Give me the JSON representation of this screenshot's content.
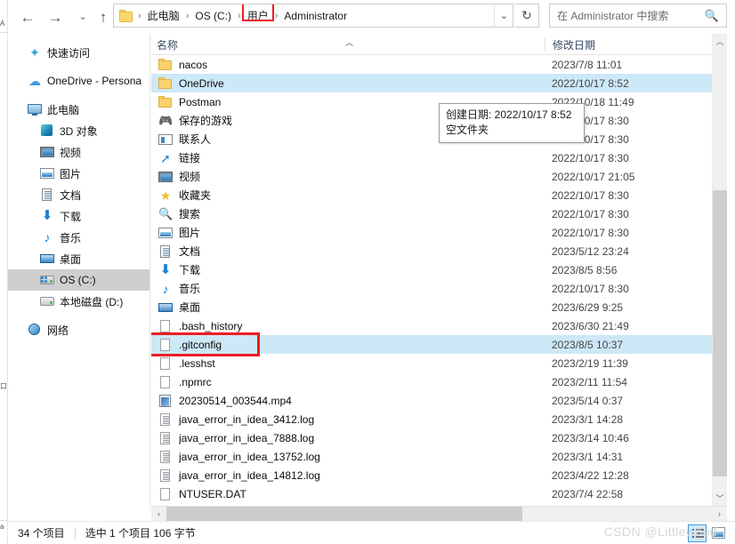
{
  "toolbar": {
    "back_label": "←",
    "forward_label": "→",
    "recent_label": "⌄",
    "up_label": "↑",
    "breadcrumb": [
      "此电脑",
      "OS (C:)",
      "用户",
      "Administrator"
    ],
    "breadcrumb_highlighted_index": 2,
    "dropdown_label": "⌄",
    "refresh_label": "↻",
    "search_placeholder": "在 Administrator 中搜索",
    "search_value": "",
    "search_icon": "search-icon"
  },
  "sidebar": {
    "items": [
      {
        "label": "快速访问",
        "icon": "pin-star-icon",
        "indent": 0,
        "selected": false
      },
      {
        "label": "OneDrive - Persona",
        "icon": "cloud-icon",
        "indent": 0,
        "selected": false
      },
      {
        "label": "此电脑",
        "icon": "this-pc-monitor-icon",
        "indent": 0,
        "selected": false
      },
      {
        "label": "3D 对象",
        "icon": "3d-objects-icon",
        "indent": 1,
        "selected": false
      },
      {
        "label": "视频",
        "icon": "videos-icon",
        "indent": 1,
        "selected": false
      },
      {
        "label": "图片",
        "icon": "pictures-icon",
        "indent": 1,
        "selected": false
      },
      {
        "label": "文档",
        "icon": "documents-icon",
        "indent": 1,
        "selected": false
      },
      {
        "label": "下载",
        "icon": "downloads-icon",
        "indent": 1,
        "selected": false
      },
      {
        "label": "音乐",
        "icon": "music-icon",
        "indent": 1,
        "selected": false
      },
      {
        "label": "桌面",
        "icon": "desktop-icon",
        "indent": 1,
        "selected": false
      },
      {
        "label": "OS (C:)",
        "icon": "os-drive-icon",
        "indent": 1,
        "selected": true
      },
      {
        "label": "本地磁盘 (D:)",
        "icon": "local-disk-icon",
        "indent": 1,
        "selected": false
      },
      {
        "label": "网络",
        "icon": "network-icon",
        "indent": 0,
        "selected": false
      }
    ]
  },
  "list": {
    "columns": {
      "name": "名称",
      "date_modified": "修改日期"
    },
    "sort_arrow": "︿",
    "rows": [
      {
        "name": "nacos",
        "date": "2023/7/8 11:01",
        "icon": "folder-icon",
        "selected": false,
        "outlined": false
      },
      {
        "name": "OneDrive",
        "date": "2022/10/17 8:52",
        "icon": "folder-icon",
        "selected": true,
        "outlined": false
      },
      {
        "name": "Postman",
        "date": "2022/10/18 11:49",
        "icon": "folder-icon",
        "selected": false,
        "outlined": false
      },
      {
        "name": "保存的游戏",
        "date": "2022/10/17 8:30",
        "icon": "saved-games-icon",
        "selected": false,
        "outlined": false
      },
      {
        "name": "联系人",
        "date": "2022/10/17 8:30",
        "icon": "contacts-icon",
        "selected": false,
        "outlined": false
      },
      {
        "name": "链接",
        "date": "2022/10/17 8:30",
        "icon": "links-icon",
        "selected": false,
        "outlined": false
      },
      {
        "name": "视频",
        "date": "2022/10/17 21:05",
        "icon": "videos-icon",
        "selected": false,
        "outlined": false
      },
      {
        "name": "收藏夹",
        "date": "2022/10/17 8:30",
        "icon": "favorites-star-icon",
        "selected": false,
        "outlined": false
      },
      {
        "name": "搜索",
        "date": "2022/10/17 8:30",
        "icon": "searches-icon",
        "selected": false,
        "outlined": false
      },
      {
        "name": "图片",
        "date": "2022/10/17 8:30",
        "icon": "pictures-icon",
        "selected": false,
        "outlined": false
      },
      {
        "name": "文档",
        "date": "2023/5/12 23:24",
        "icon": "documents-icon",
        "selected": false,
        "outlined": false
      },
      {
        "name": "下载",
        "date": "2023/8/5 8:56",
        "icon": "downloads-icon",
        "selected": false,
        "outlined": false
      },
      {
        "name": "音乐",
        "date": "2022/10/17 8:30",
        "icon": "music-icon",
        "selected": false,
        "outlined": false
      },
      {
        "name": "桌面",
        "date": "2023/6/29 9:25",
        "icon": "desktop-icon",
        "selected": false,
        "outlined": false
      },
      {
        "name": ".bash_history",
        "date": "2023/6/30 21:49",
        "icon": "file-blank-icon",
        "selected": false,
        "outlined": false
      },
      {
        "name": ".gitconfig",
        "date": "2023/8/5 10:37",
        "icon": "file-blank-icon",
        "selected": true,
        "outlined": true
      },
      {
        "name": ".lesshst",
        "date": "2023/2/19 11:39",
        "icon": "file-blank-icon",
        "selected": false,
        "outlined": false
      },
      {
        "name": ".npmrc",
        "date": "2023/2/11 11:54",
        "icon": "file-blank-icon",
        "selected": false,
        "outlined": false
      },
      {
        "name": "20230514_003544.mp4",
        "date": "2023/5/14 0:37",
        "icon": "video-file-icon",
        "selected": false,
        "outlined": false
      },
      {
        "name": "java_error_in_idea_3412.log",
        "date": "2023/3/1 14:28",
        "icon": "log-file-icon",
        "selected": false,
        "outlined": false
      },
      {
        "name": "java_error_in_idea_7888.log",
        "date": "2023/3/14 10:46",
        "icon": "log-file-icon",
        "selected": false,
        "outlined": false
      },
      {
        "name": "java_error_in_idea_13752.log",
        "date": "2023/3/1 14:31",
        "icon": "log-file-icon",
        "selected": false,
        "outlined": false
      },
      {
        "name": "java_error_in_idea_14812.log",
        "date": "2023/4/22 12:28",
        "icon": "log-file-icon",
        "selected": false,
        "outlined": false
      },
      {
        "name": "NTUSER.DAT",
        "date": "2023/7/4 22:58",
        "icon": "file-blank-icon",
        "selected": false,
        "outlined": false
      }
    ]
  },
  "tooltip": {
    "line1": "创建日期: 2022/10/17 8:52",
    "line2": "空文件夹"
  },
  "status": {
    "item_count": "34 个项目",
    "selection": "选中 1 个项目  106 字节"
  },
  "scrollbars": {
    "v_up": "︿",
    "v_down": "﹀",
    "h_left": "‹",
    "h_right": "›"
  },
  "watermark": "CSDN @Littlewood",
  "colors": {
    "selection_blue": "#cde8f7",
    "nav_selection_gray": "#cfcfcf",
    "highlight_red": "#ee1d24",
    "header_text": "#3a4a63",
    "folder_yellow": "#fbd26b"
  }
}
